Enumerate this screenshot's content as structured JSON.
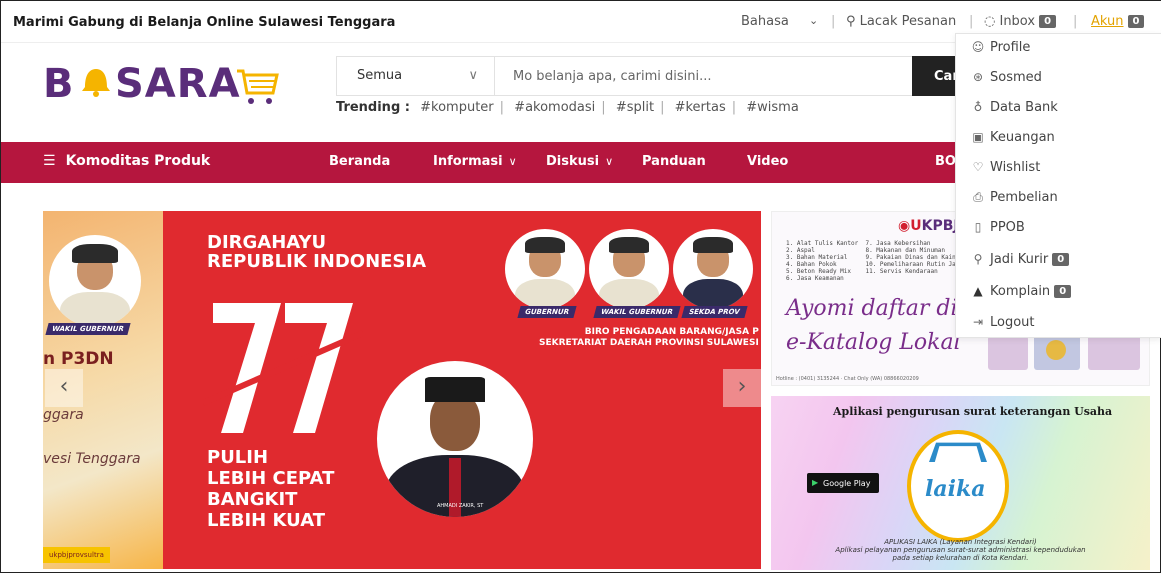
{
  "topbar": {
    "tagline": "Marimi Gabung di Belanja Online Sulawesi Tenggara",
    "language": "Bahasa",
    "track_order": "Lacak Pesanan",
    "inbox": "Inbox",
    "inbox_count": "0",
    "account": "Akun",
    "account_count": "0"
  },
  "logo": {
    "text_left": "B",
    "text_right": "SARA"
  },
  "search": {
    "category": "Semua",
    "placeholder": "Mo belanja apa, carimi disini...",
    "button": "Car"
  },
  "trending": {
    "label": "Trending :",
    "tags": [
      "#komputer",
      "#akomodasi",
      "#split",
      "#kertas",
      "#wisma"
    ]
  },
  "nav": {
    "categories": "Komoditas Produk",
    "items": [
      "Beranda",
      "Informasi",
      "Diskusi",
      "Panduan",
      "Video",
      "BO"
    ]
  },
  "banner": {
    "left_title": "n P3DN",
    "left_sub1": "ggara",
    "left_sub2": "vesi Tenggara",
    "wakil_tag": "WAKIL GUBERNUR",
    "ig_tag": "ukpbjprovsultra",
    "headline": "DIRGAHAYU\nREPUBLIK INDONESIA",
    "number": "77",
    "slogan": "PULIH\nLEBIH CEPAT\nBANGKIT\nLEBIH KUAT",
    "roles": [
      "GUBERNUR",
      "WAKIL GUBERNUR",
      "SEKDA PROV"
    ],
    "biro": "BIRO PENGADAAN BARANG/JASA P\nSEKRETARIAT DAERAH PROVINSI SULAWESI",
    "speaker_name": "AHMADI ZAKIR, ST"
  },
  "ad1": {
    "brand_prefix": "U",
    "brand": "KPBJ",
    "list": "1. Alat Tulis Kantor  7. Jasa Kebersihan\n2. Aspal              8. Makanan dan Minuman\n3. Bahan Material     9. Pakaian Dinas dan Kain Tradisional\n4. Bahan Pokok        10. Pemeliharaan Rutin Jalan\n5. Beton Ready Mix    11. Servis Kendaraan\n6. Jasa Keamanan",
    "script1": "Ayomi daftar di",
    "script2": "e-Katalog Lokal",
    "footer": "Hotline : (0401) 3135244 · Chat Only (WA) 08866020209"
  },
  "ad2": {
    "title": "Aplikasi pengurusan surat keterangan Usaha",
    "store": "Google Play",
    "app": "laika",
    "caption1": "APLIKASI LAIKA (Layanan Integrasi Kendari)",
    "caption2": "Aplikasi pelayanan pengurusan surat-surat administrasi kependudukan",
    "caption3": "pada setiap kelurahan di Kota Kendari."
  },
  "dropdown": {
    "items": [
      {
        "label": "Profile",
        "icon": "user-icon",
        "glyph": "☺"
      },
      {
        "label": "Sosmed",
        "icon": "share-icon",
        "glyph": "⊛"
      },
      {
        "label": "Data Bank",
        "icon": "bank-icon",
        "glyph": "♁"
      },
      {
        "label": "Keuangan",
        "icon": "money-icon",
        "glyph": "▣"
      },
      {
        "label": "Wishlist",
        "icon": "heart-icon",
        "glyph": "♡"
      },
      {
        "label": "Pembelian",
        "icon": "bag-icon",
        "glyph": "⎙"
      },
      {
        "label": "PPOB",
        "icon": "phone-icon",
        "glyph": "▯"
      },
      {
        "label": "Jadi Kurir",
        "icon": "bike-icon",
        "glyph": "⚲",
        "count": "0"
      },
      {
        "label": "Komplain",
        "icon": "warning-icon",
        "glyph": "▲",
        "count": "0"
      },
      {
        "label": "Logout",
        "icon": "logout-icon",
        "glyph": "⇥"
      }
    ]
  },
  "colors": {
    "nav_bg": "#b5163e",
    "logo": "#5a2d7a",
    "accent": "#f5b400"
  }
}
